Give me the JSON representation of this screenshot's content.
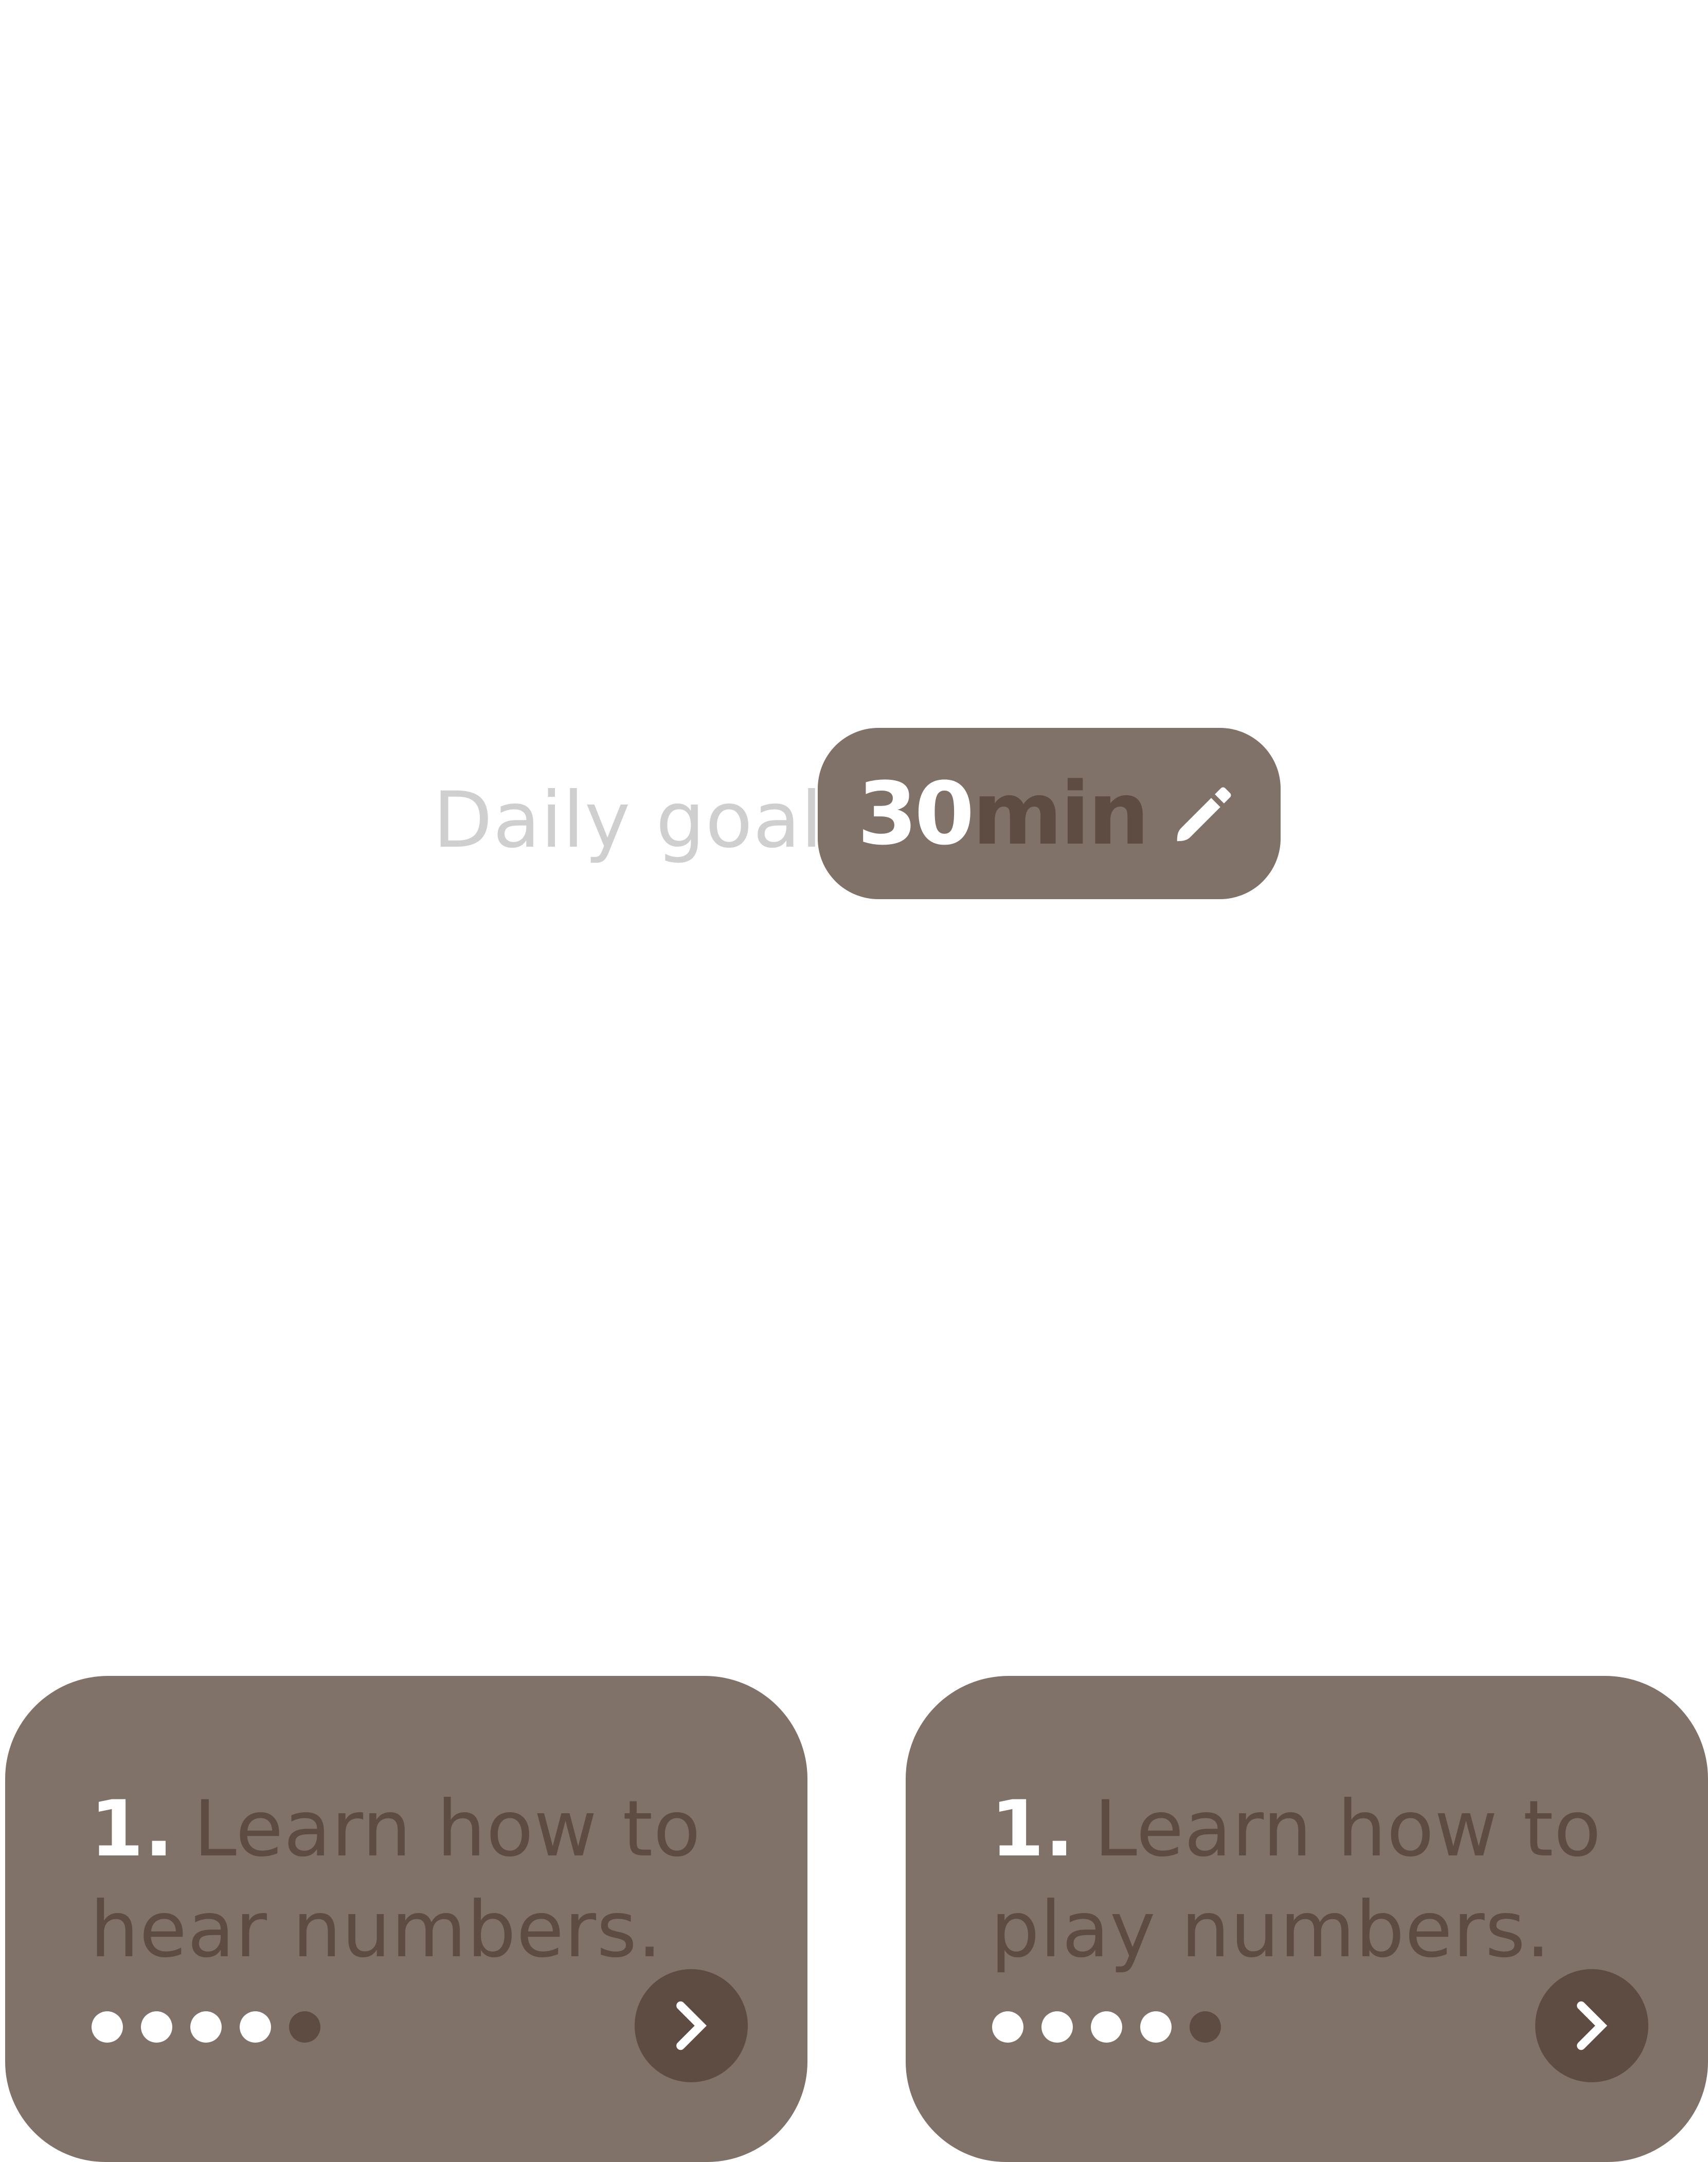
{
  "colors": {
    "background": "#ffffff",
    "card": "#807268",
    "dark": "#5e4b42",
    "light_text": "#cfcfcf",
    "white": "#ffffff"
  },
  "daily_goal": {
    "label": "Daily goal",
    "value": "30",
    "unit": "min",
    "edit_icon": "pencil-icon"
  },
  "lessons": [
    {
      "number": "1.",
      "title": "Learn how to hear numbers.",
      "progress": {
        "completed": 4,
        "total": 5
      },
      "next_icon": "chevron-right-icon"
    },
    {
      "number": "1.",
      "title": "Learn how to play numbers.",
      "progress": {
        "completed": 4,
        "total": 5
      },
      "next_icon": "chevron-right-icon"
    }
  ]
}
